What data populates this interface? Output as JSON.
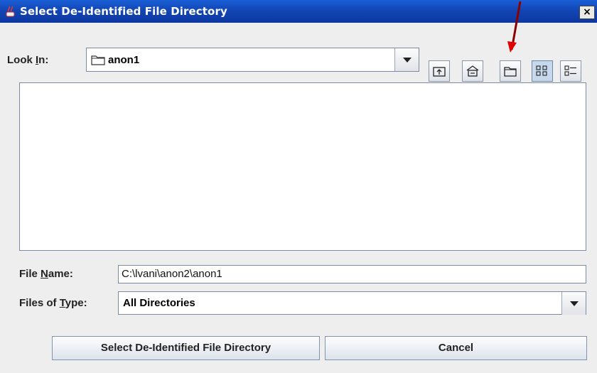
{
  "window": {
    "title": "Select De-Identified File Directory",
    "close_glyph": "×",
    "icons": {
      "app": "java-cup-icon",
      "close": "close-icon"
    }
  },
  "look_in": {
    "label_before": "Look ",
    "label_mnemonic": "I",
    "label_after": "n:",
    "value": "anon1",
    "icon": "folder-icon"
  },
  "toolbar": {
    "buttons": [
      {
        "name": "up-one-level",
        "icon": "up-folder-icon"
      },
      {
        "name": "home",
        "icon": "home-icon"
      },
      {
        "name": "create-new-folder",
        "icon": "new-folder-icon"
      },
      {
        "name": "list-view",
        "icon": "list-view-icon",
        "selected": true
      },
      {
        "name": "details-view",
        "icon": "details-view-icon",
        "selected": false
      }
    ]
  },
  "annotation": {
    "arrow_color": "#d40000"
  },
  "file_name": {
    "label_before": "File ",
    "label_mnemonic": "N",
    "label_after": "ame:",
    "value": "C:\\lvani\\anon2\\anon1"
  },
  "files_of_type": {
    "label_before": "Files of ",
    "label_mnemonic": "T",
    "label_after": "ype:",
    "value": "All Directories"
  },
  "buttons": {
    "select": "Select De-Identified File Directory",
    "cancel": "Cancel"
  },
  "colors": {
    "titlebar": "#1246b5",
    "background": "#eeeeee"
  }
}
